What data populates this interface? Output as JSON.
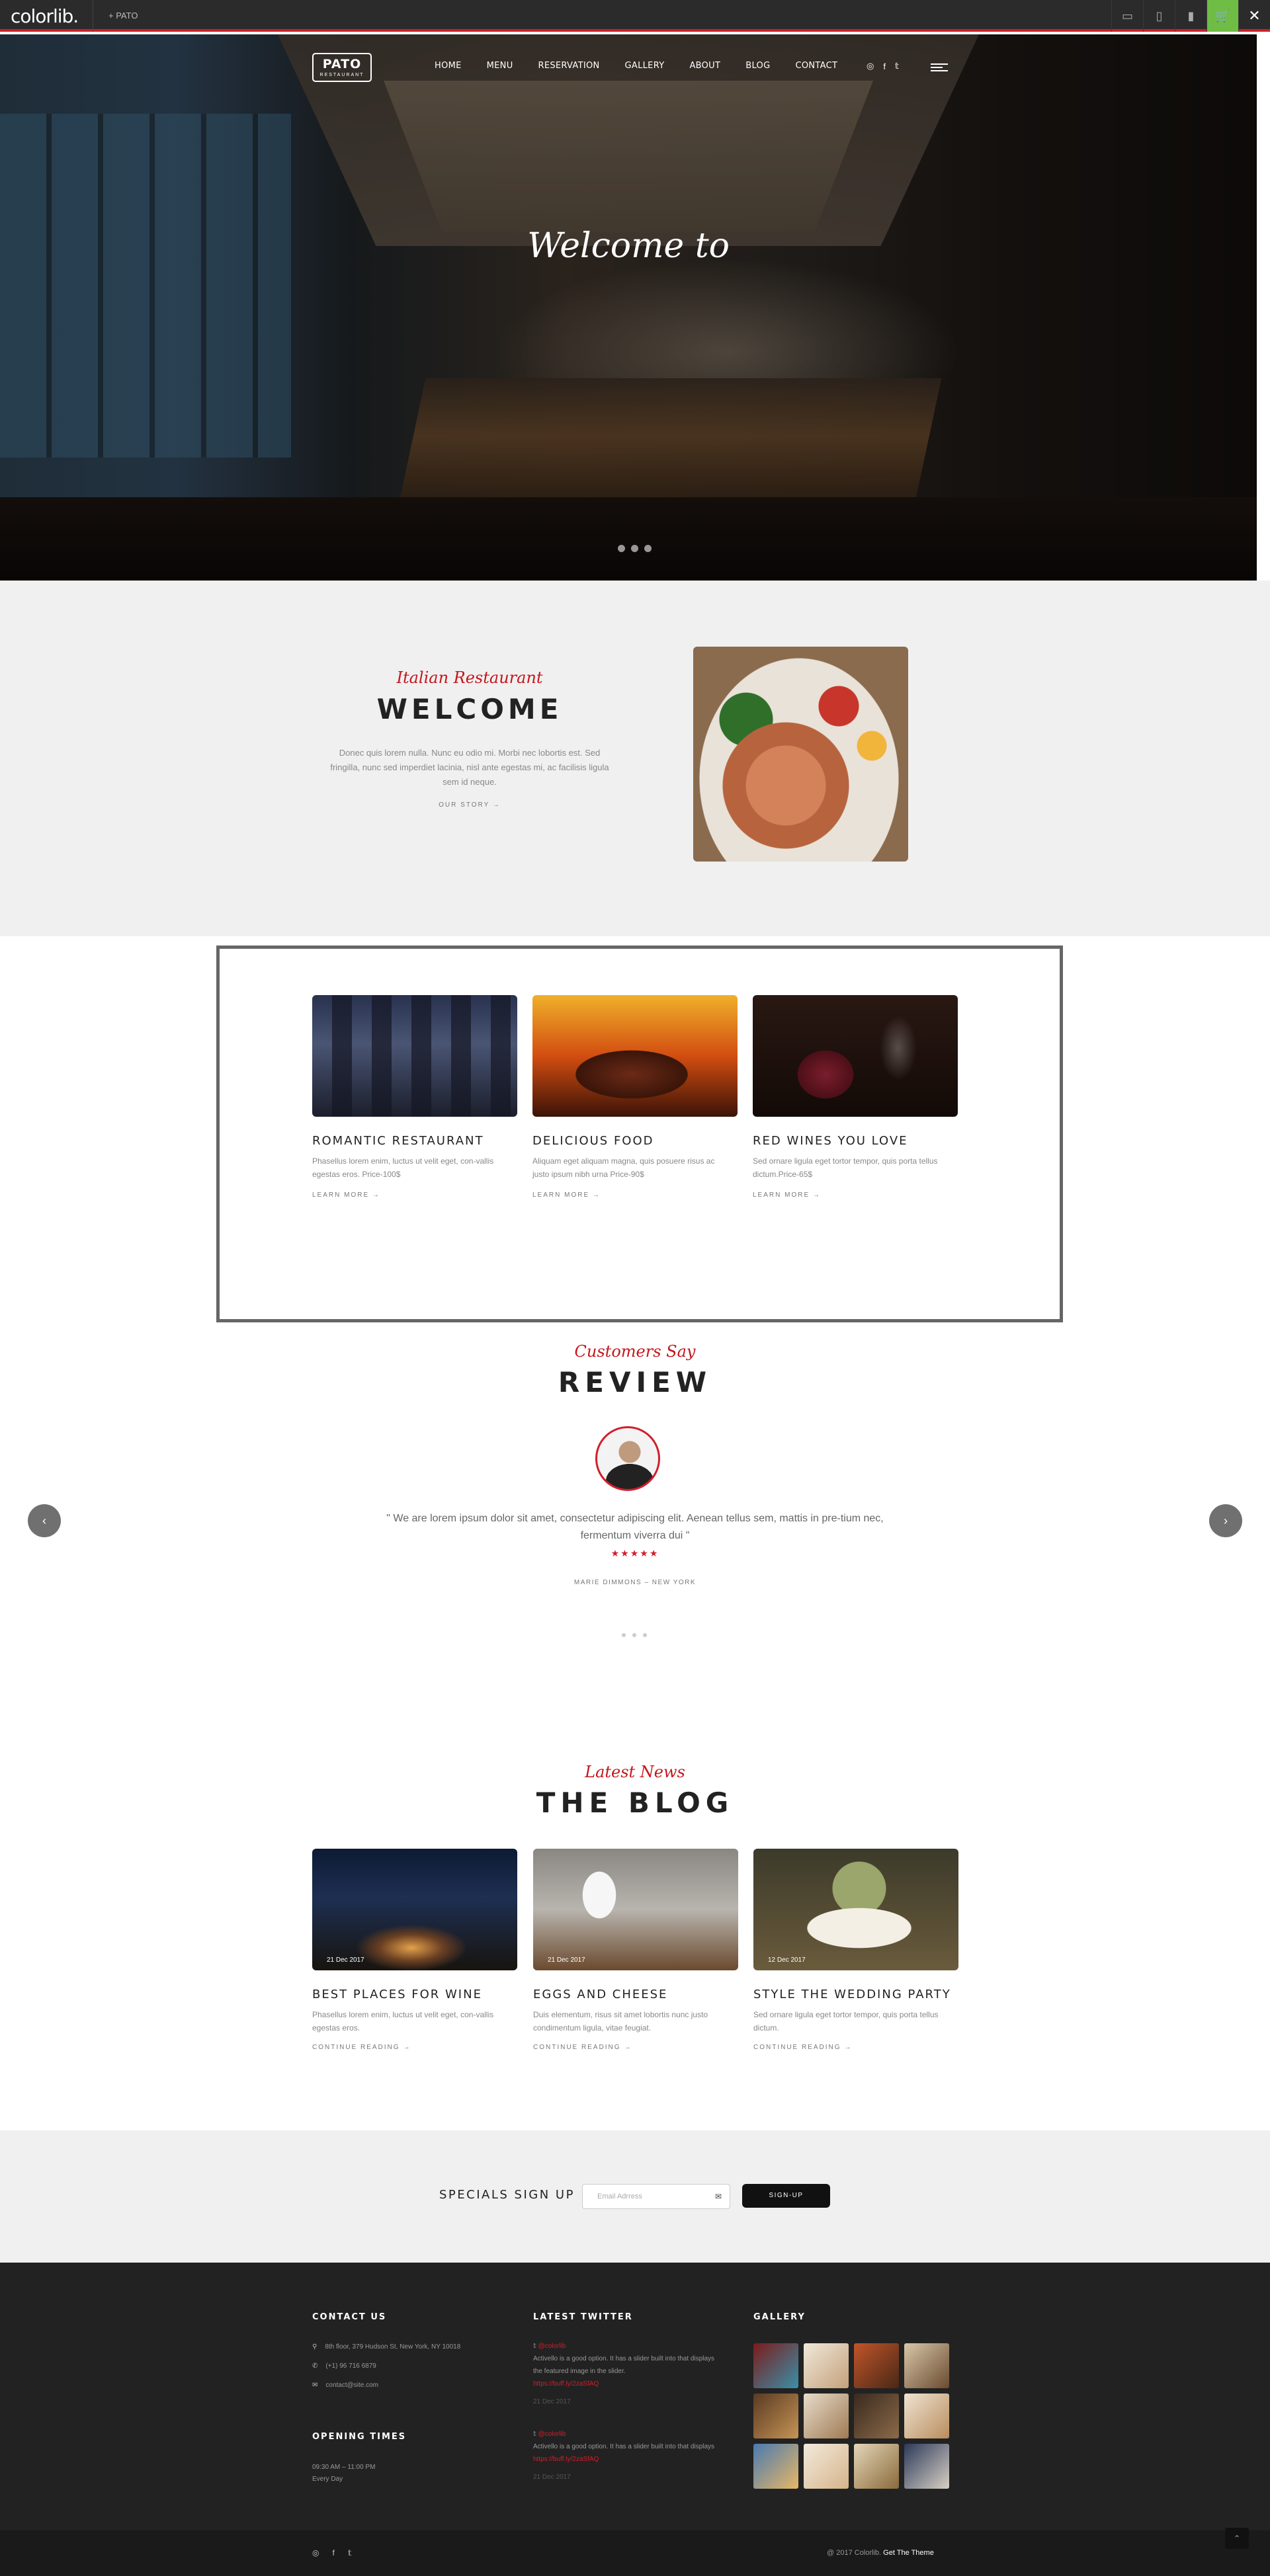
{
  "topbar": {
    "brand": "colorlib.",
    "theme_tab": "+ PATO",
    "icons": [
      "desktop-icon",
      "tablet-icon",
      "mobile-icon",
      "cart-icon",
      "close-icon"
    ]
  },
  "hero": {
    "logo_title": "PATO",
    "logo_sub": "RESTAURANT",
    "menu": [
      "HOME",
      "MENU",
      "RESERVATION",
      "GALLERY",
      "ABOUT",
      "BLOG",
      "CONTACT"
    ],
    "social": [
      "tripadvisor-icon",
      "facebook-icon",
      "twitter-icon"
    ],
    "title": "Welcome to"
  },
  "welcome": {
    "script": "Italian Restaurant",
    "title": "WELCOME",
    "text": "Donec quis lorem nulla. Nunc eu odio mi. Morbi nec lobortis est. Sed fringilla, nunc sed imperdiet lacinia, nisl ante egestas mi, ac facilisis ligula sem id neque.",
    "link": "OUR STORY  →"
  },
  "features": [
    {
      "title": "ROMANTIC RESTAURANT",
      "text": "Phasellus lorem enim, luctus ut velit eget, con-vallis egestas eros. Price-100$",
      "more": "LEARN MORE  →"
    },
    {
      "title": "DELICIOUS FOOD",
      "text": "Aliquam eget aliquam magna, quis posuere risus ac justo ipsum nibh urna Price-90$",
      "more": "LEARN MORE  →"
    },
    {
      "title": "RED WINES YOU LOVE",
      "text": "Sed ornare ligula eget tortor tempor, quis porta tellus dictum.Price-65$",
      "more": "LEARN MORE  →"
    }
  ],
  "review": {
    "script": "Customers Say",
    "title": "REVIEW",
    "quote": "\" We are lorem ipsum dolor sit amet, consectetur adipiscing elit. Aenean tellus sem, mattis in pre-tium nec, fermentum viverra dui \"",
    "stars": "★★★★★",
    "author": "MARIE DIMMONS – NEW YORK",
    "prev": "‹",
    "next": "›"
  },
  "blog": {
    "script": "Latest News",
    "title": "THE BLOG",
    "posts": [
      {
        "date": "21 Dec 2017",
        "title": "BEST PLACES FOR WINE",
        "text": "Phasellus lorem enim, luctus ut velit eget, con-vallis egestas eros.",
        "more": "CONTINUE READING  →"
      },
      {
        "date": "21 Dec 2017",
        "title": "EGGS AND CHEESE",
        "text": "Duis elementum, risus sit amet lobortis nunc justo condimentum ligula, vitae feugiat.",
        "more": "CONTINUE READING  →"
      },
      {
        "date": "12 Dec 2017",
        "title": "STYLE THE WEDDING PARTY",
        "text": "Sed ornare ligula eget tortor tempor, quis porta tellus dictum.",
        "more": "CONTINUE READING  →"
      }
    ]
  },
  "signup": {
    "label": "SPECIALS SIGN UP",
    "placeholder": "Email Adrress",
    "button": "SIGN-UP"
  },
  "footer": {
    "contact_title": "CONTACT US",
    "address": "8th floor, 379 Hudson St, New York, NY 10018",
    "phone": "(+1) 96 716 6879",
    "email": "contact@site.com",
    "hours_title": "OPENING TIMES",
    "hours": "09:30 AM – 11:00 PM",
    "days": "Every Day",
    "twitter_title": "LATEST TWITTER",
    "tweets": [
      {
        "handle": "@colorlib",
        "text": "Activello is a good option. It has a slider built into that displays the featured image in the slider.",
        "url": "https://buff.ly/2zaSfAQ",
        "date": "21 Dec 2017"
      },
      {
        "handle": "@colorlib",
        "text": "Activello is a good option. It has a slider built into that displays",
        "url": "https://buff.ly/2zaSfAQ",
        "date": "21 Dec 2017"
      }
    ],
    "gallery_title": "GALLERY",
    "copyright_prefix": "@ 2017 Colorlib.",
    "copyright_link": "Get The Theme"
  }
}
